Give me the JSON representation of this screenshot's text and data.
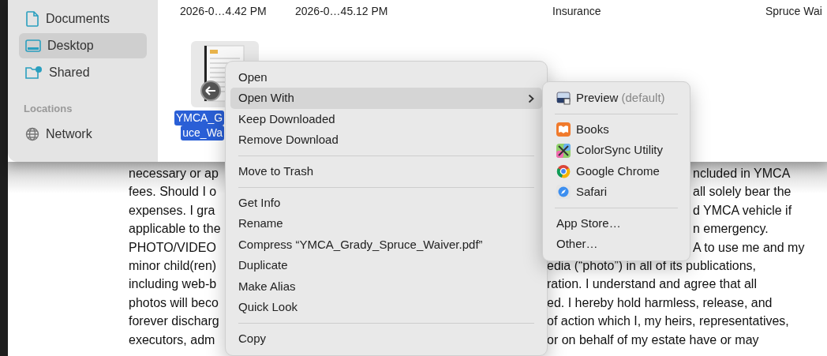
{
  "finder": {
    "header_cells": [
      "2026-0…4.42 PM",
      "2026-0…45.12 PM",
      "Insurance",
      "Spruce Wai"
    ],
    "sidebar": {
      "items": [
        {
          "label": "Documents",
          "selected": false
        },
        {
          "label": "Desktop",
          "selected": true
        },
        {
          "label": "Shared",
          "selected": false
        }
      ],
      "section": "Locations",
      "location_items": [
        {
          "label": "Network",
          "selected": false
        }
      ]
    },
    "file": {
      "name_lines": [
        "YMCA_G",
        "uce_Wa"
      ],
      "selected": true
    }
  },
  "document": {
    "lines": [
      {
        "left": "necessary or ap",
        "right": "ncluded in YMCA"
      },
      {
        "left": "fees. Should I o",
        "right": "all solely bear the"
      },
      {
        "left": "expenses. I gra",
        "right": "d YMCA vehicle if"
      },
      {
        "left": "applicable to the",
        "right": "n emergency."
      },
      {
        "left": "PHOTO/VIDEO",
        "right": "A to use me and my"
      },
      {
        "left": "minor child(ren)",
        "right": "edia (“photo”) in all of its publications,"
      },
      {
        "left": "including web-b",
        "right": "ration. I understand and agree that all"
      },
      {
        "left": "photos will beco",
        "right": "ed. I hereby hold harmless, release, and"
      },
      {
        "left": "forever discharg",
        "right": "of action which I, my heirs, representatives,"
      },
      {
        "left": "executors, adm",
        "right": "or on behalf of my estate have or may"
      }
    ]
  },
  "context_menu": {
    "items": [
      {
        "kind": "item",
        "label": "Open",
        "selected": false
      },
      {
        "kind": "item",
        "label": "Open With",
        "selected": true,
        "submenu": true
      },
      {
        "kind": "item",
        "label": "Keep Downloaded",
        "selected": false
      },
      {
        "kind": "item",
        "label": "Remove Download",
        "selected": false
      },
      {
        "kind": "separator"
      },
      {
        "kind": "item",
        "label": "Move to Trash",
        "selected": false
      },
      {
        "kind": "separator"
      },
      {
        "kind": "item",
        "label": "Get Info",
        "selected": false
      },
      {
        "kind": "item",
        "label": "Rename",
        "selected": false
      },
      {
        "kind": "item",
        "label": "Compress “YMCA_Grady_Spruce_Waiver.pdf”",
        "selected": false
      },
      {
        "kind": "item",
        "label": "Duplicate",
        "selected": false
      },
      {
        "kind": "item",
        "label": "Make Alias",
        "selected": false
      },
      {
        "kind": "item",
        "label": "Quick Look",
        "selected": false
      },
      {
        "kind": "separator"
      },
      {
        "kind": "item",
        "label": "Copy",
        "selected": false
      }
    ]
  },
  "submenu": {
    "items": [
      {
        "kind": "app",
        "label": "Preview",
        "note": "(default)"
      },
      {
        "kind": "separator"
      },
      {
        "kind": "app",
        "label": "Books"
      },
      {
        "kind": "app",
        "label": "ColorSync Utility"
      },
      {
        "kind": "app",
        "label": "Google Chrome"
      },
      {
        "kind": "app",
        "label": "Safari"
      },
      {
        "kind": "separator"
      },
      {
        "kind": "item",
        "label": "App Store…"
      },
      {
        "kind": "item",
        "label": "Other…"
      }
    ]
  }
}
